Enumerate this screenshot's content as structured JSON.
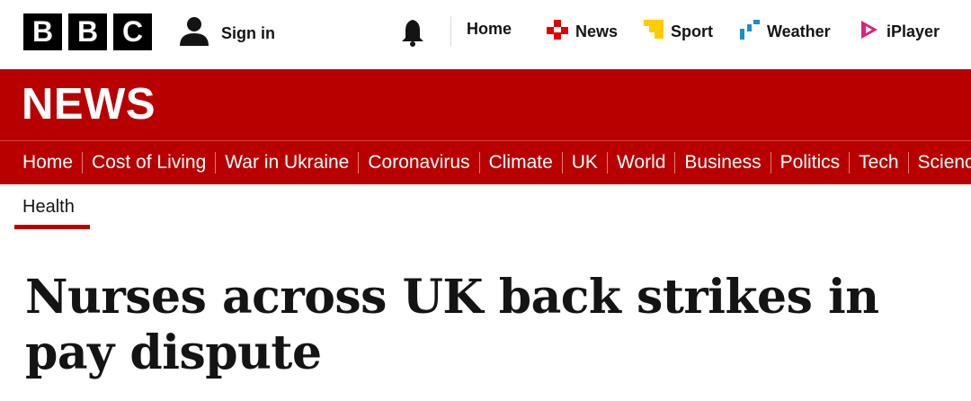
{
  "masthead": {
    "logo_letters": [
      "B",
      "B",
      "C"
    ],
    "signin_label": "Sign in",
    "nav": [
      {
        "label": "Home",
        "icon": "none"
      },
      {
        "label": "News",
        "icon": "news-icon",
        "color": "#e00000"
      },
      {
        "label": "Sport",
        "icon": "sport-icon",
        "color": "#ffcc00"
      },
      {
        "label": "Weather",
        "icon": "weather-icon",
        "color": "#1a8ccf"
      },
      {
        "label": "iPlayer",
        "icon": "iplayer-icon",
        "color": "#e0207a"
      }
    ]
  },
  "news_band": {
    "title": "NEWS",
    "background": "#b80000"
  },
  "subnav": {
    "items": [
      "Home",
      "Cost of Living",
      "War in Ukraine",
      "Coronavirus",
      "Climate",
      "UK",
      "World",
      "Business",
      "Politics",
      "Tech",
      "Science"
    ]
  },
  "section": {
    "label": "Health"
  },
  "article": {
    "headline": "Nurses across UK back strikes in pay dispute"
  }
}
